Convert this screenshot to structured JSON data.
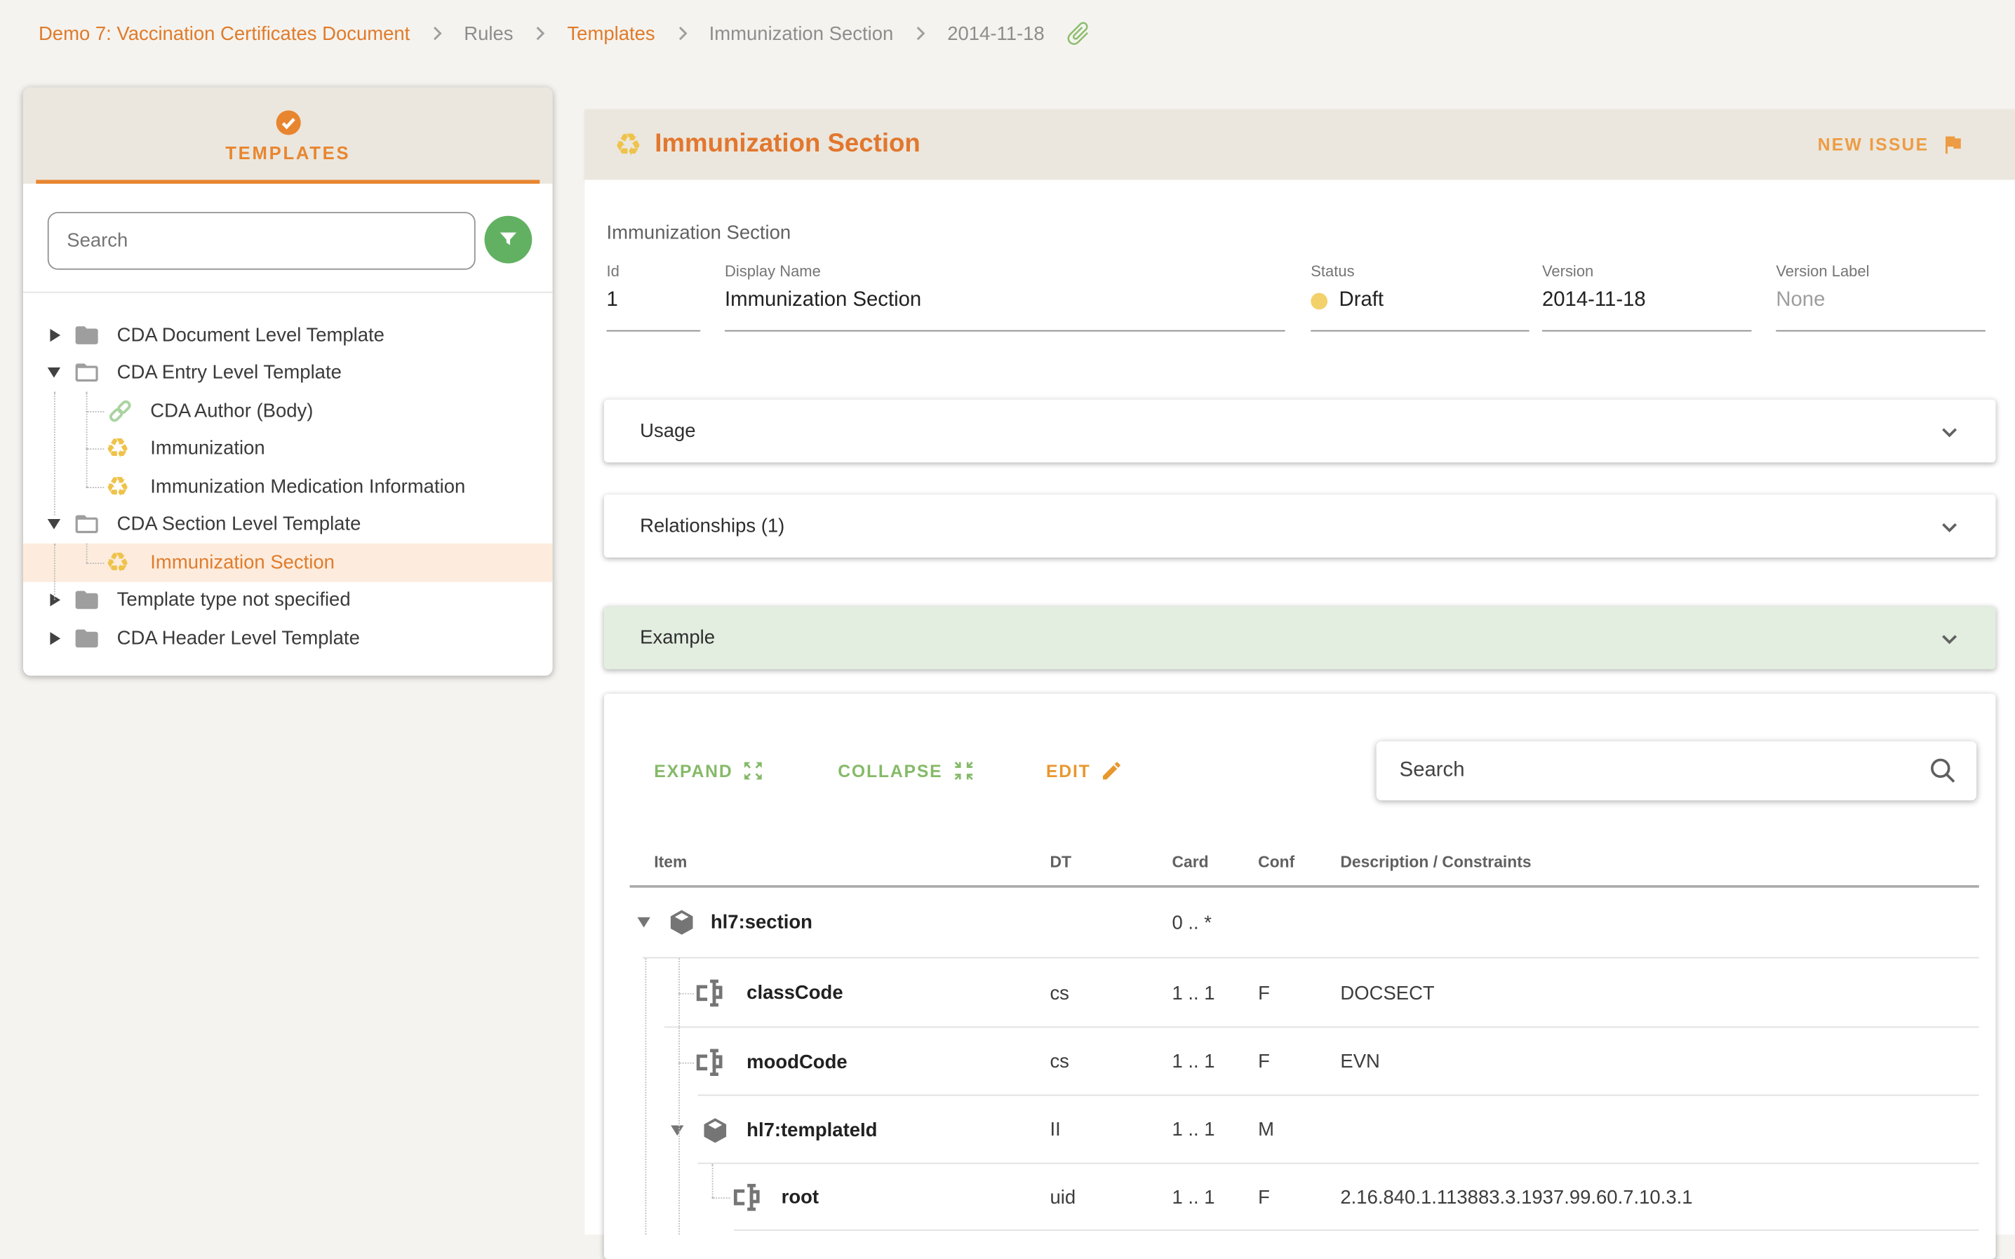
{
  "breadcrumb": {
    "items": [
      {
        "label": "Demo 7: Vaccination Certificates Document",
        "active": true
      },
      {
        "label": "Rules",
        "active": false
      },
      {
        "label": "Templates",
        "active": true
      },
      {
        "label": "Immunization Section",
        "active": false
      },
      {
        "label": "2014-11-18",
        "active": false
      }
    ]
  },
  "icons": {
    "recycle": "♻"
  },
  "colors": {
    "accent_orange": "#e07c2c",
    "muted_green": "#85ba68",
    "amber_icon": "#efc24a",
    "status_yellow": "#f2d16b",
    "beige_header": "#ebe7de",
    "selected_row_bg": "#fdecdd",
    "example_green_bg": "#e3eee0"
  },
  "sidebar": {
    "tab_label": "TEMPLATES",
    "search_placeholder": "Search",
    "tree": [
      {
        "label": "CDA Document Level Template"
      },
      {
        "label": "CDA Entry Level Template"
      },
      {
        "label": "CDA Author (Body)"
      },
      {
        "label": "Immunization"
      },
      {
        "label": "Immunization Medication Information"
      },
      {
        "label": "CDA Section Level Template"
      },
      {
        "label": "Immunization Section"
      },
      {
        "label": "Template type not specified"
      },
      {
        "label": "CDA Header Level Template"
      }
    ]
  },
  "header": {
    "title": "Immunization Section",
    "new_issue_label": "NEW ISSUE"
  },
  "meta": {
    "name": "Immunization Section",
    "id_label": "Id",
    "id_value": "1",
    "display_name_label": "Display Name",
    "display_name_value": "Immunization Section",
    "status_label": "Status",
    "status_value": "Draft",
    "version_label": "Version",
    "version_value": "2014-11-18",
    "version_label_label": "Version Label",
    "version_label_value": "None"
  },
  "accordions": {
    "usage": "Usage",
    "relationships": "Relationships (1)",
    "example": "Example"
  },
  "table": {
    "expand_label": "EXPAND",
    "collapse_label": "COLLAPSE",
    "edit_label": "EDIT",
    "search_placeholder": "Search",
    "columns": {
      "item": "Item",
      "dt": "DT",
      "card": "Card",
      "conf": "Conf",
      "desc": "Description / Constraints"
    },
    "rows": [
      {
        "name": "hl7:section",
        "dt": "",
        "card": "0 .. *",
        "conf": "",
        "desc": ""
      },
      {
        "name": "classCode",
        "dt": "cs",
        "card": "1 .. 1",
        "conf": "F",
        "desc": "DOCSECT"
      },
      {
        "name": "moodCode",
        "dt": "cs",
        "card": "1 .. 1",
        "conf": "F",
        "desc": "EVN"
      },
      {
        "name": "hl7:templateId",
        "dt": "II",
        "card": "1 .. 1",
        "conf": "M",
        "desc": ""
      },
      {
        "name": "root",
        "dt": "uid",
        "card": "1 .. 1",
        "conf": "F",
        "desc": "2.16.840.1.113883.3.1937.99.60.7.10.3.1"
      }
    ]
  }
}
